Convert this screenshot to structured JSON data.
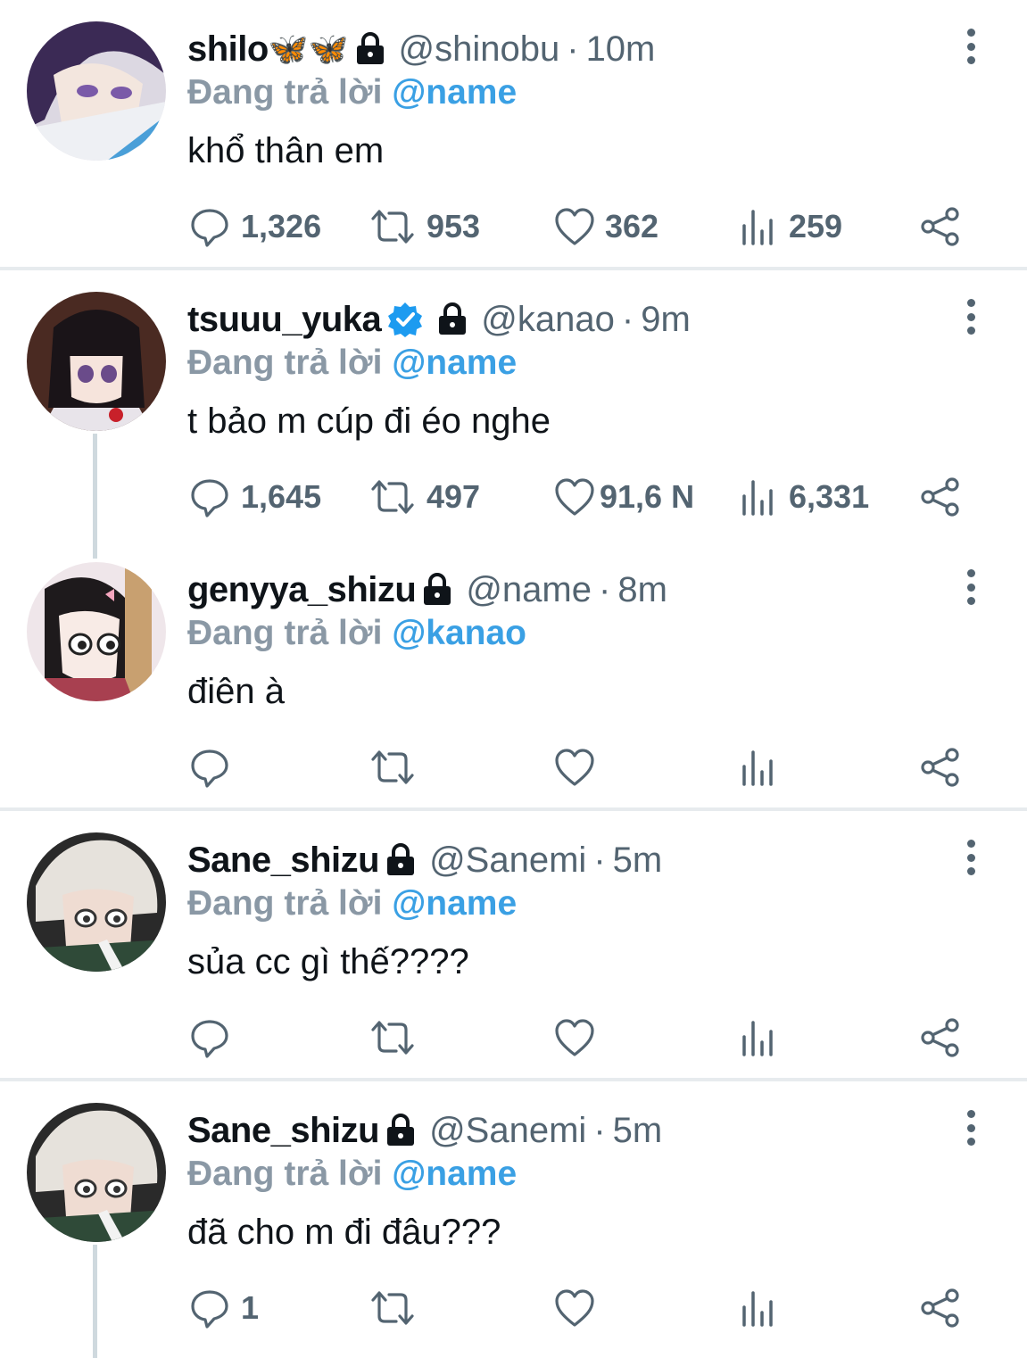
{
  "colors": {
    "accent": "#3aa0e4",
    "muted": "#536471",
    "reply_prefix": "#8a98a5",
    "divider": "#e7ebee",
    "thread_line": "#cfd9de",
    "verified": "#1d9bf0"
  },
  "tweets": [
    {
      "name": "shilo",
      "name_emoji": "🦋🦋",
      "verified": false,
      "locked": true,
      "handle": "@shinobu",
      "dot": "·",
      "time": "10m",
      "reply_prefix": "Đang trả lời ",
      "reply_mention": "@name",
      "text": "khổ thân em",
      "counts": {
        "reply": "1,326",
        "retweet": "953",
        "like": "362",
        "views": "259"
      },
      "icons": [
        "comment-icon",
        "retweet-icon",
        "heart-icon",
        "views-icon",
        "share-icon"
      ]
    },
    {
      "name": "tsuuu_yuka",
      "verified": true,
      "locked": true,
      "handle": "@kanao",
      "dot": "·",
      "time": "9m",
      "reply_prefix": "Đang trả lời ",
      "reply_mention": "@name",
      "text": "t bảo m cúp đi éo nghe",
      "counts": {
        "reply": "1,645",
        "retweet": "497",
        "like": "91,6 N",
        "views": "6,331"
      }
    },
    {
      "name": "genyya_shizu",
      "verified": false,
      "locked": true,
      "handle": "@name",
      "dot": "·",
      "time": "8m",
      "reply_prefix": "Đang trả lời ",
      "reply_mention": "@kanao",
      "text": "điên à",
      "counts": {
        "reply": "",
        "retweet": "",
        "like": "",
        "views": ""
      }
    },
    {
      "name": "Sane_shizu",
      "verified": false,
      "locked": true,
      "handle": "@Sanemi",
      "dot": "·",
      "time": "5m",
      "reply_prefix": "Đang trả lời ",
      "reply_mention": "@name",
      "text": "sủa cc gì thế????",
      "counts": {
        "reply": "",
        "retweet": "",
        "like": "",
        "views": ""
      }
    },
    {
      "name": "Sane_shizu",
      "verified": false,
      "locked": true,
      "handle": "@Sanemi",
      "dot": "·",
      "time": "5m",
      "reply_prefix": "Đang trả lời ",
      "reply_mention": "@name",
      "text": "đã cho m đi đâu???",
      "counts": {
        "reply": "1",
        "retweet": "",
        "like": "",
        "views": ""
      }
    }
  ]
}
